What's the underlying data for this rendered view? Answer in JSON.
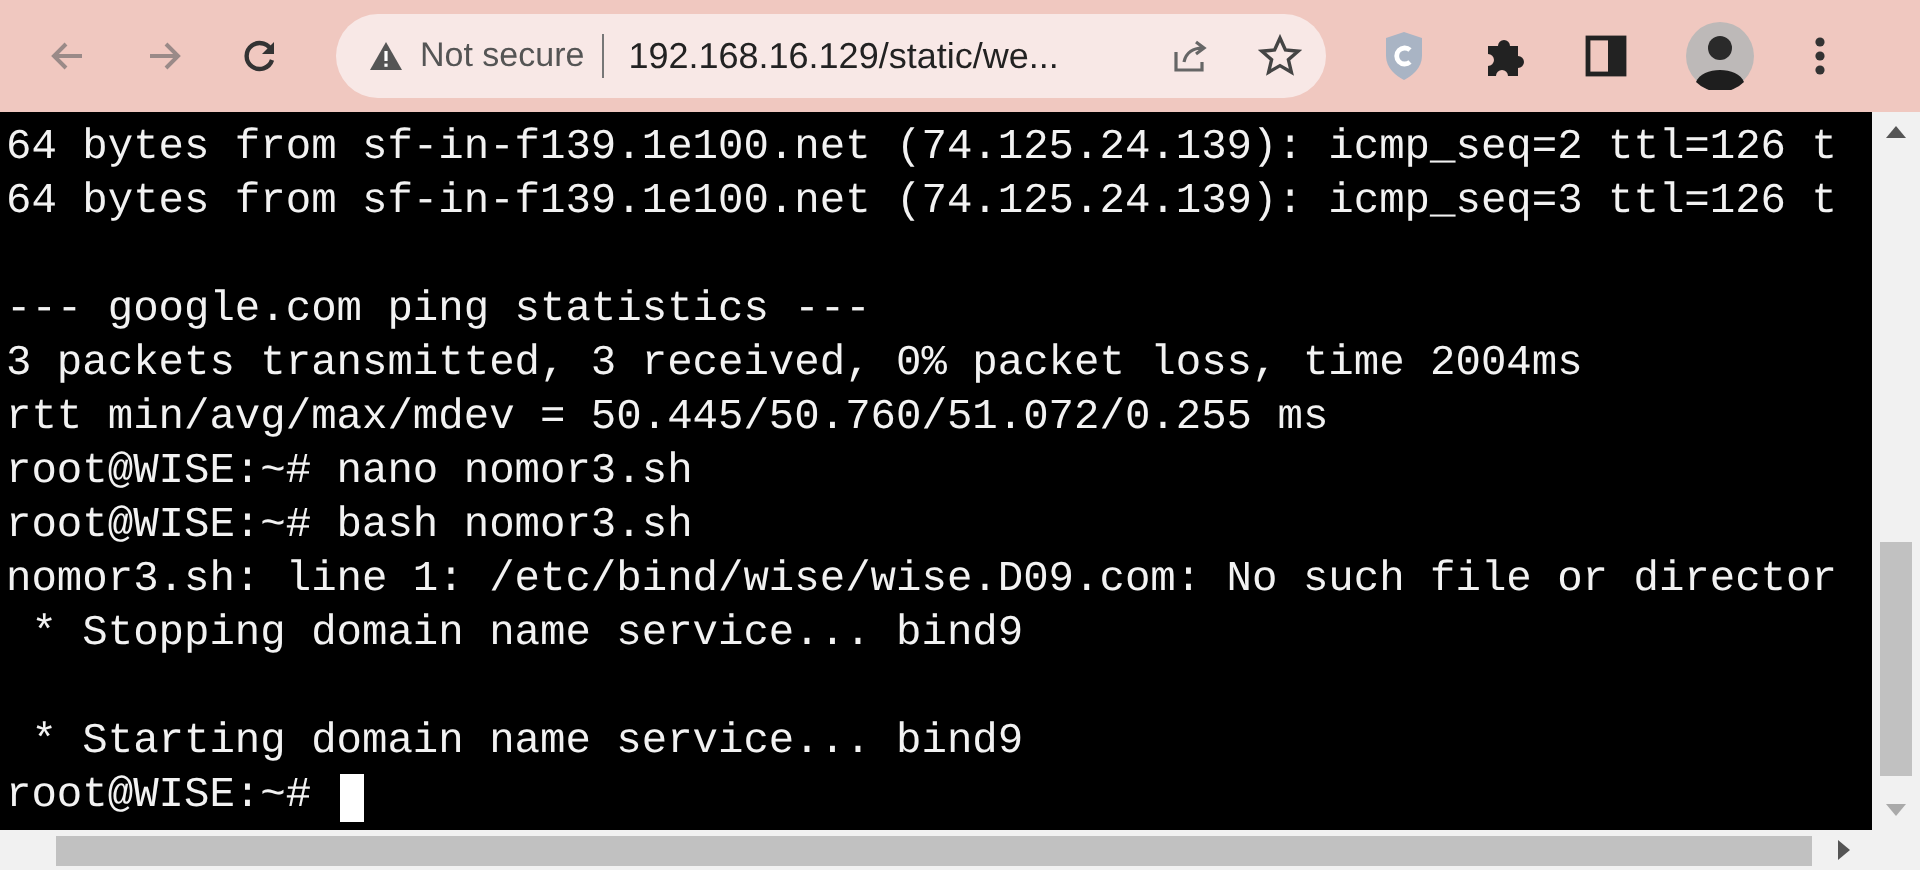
{
  "browser": {
    "security_label": "Not secure",
    "url": "192.168.16.129/static/we..."
  },
  "terminal": {
    "blocks": [
      [
        "64 bytes from sf-in-f139.1e100.net (74.125.24.139): icmp_seq=2 ttl=126 t",
        "64 bytes from sf-in-f139.1e100.net (74.125.24.139): icmp_seq=3 ttl=126 t"
      ],
      [
        "--- google.com ping statistics ---",
        "3 packets transmitted, 3 received, 0% packet loss, time 2004ms",
        "rtt min/avg/max/mdev = 50.445/50.760/51.072/0.255 ms",
        "root@WISE:~# nano nomor3.sh",
        "root@WISE:~# bash nomor3.sh",
        "nomor3.sh: line 1: /etc/bind/wise/wise.D09.com: No such file or director",
        " * Stopping domain name service... bind9"
      ],
      [
        " * Starting domain name service... bind9"
      ]
    ],
    "prompt": "root@WISE:~#"
  }
}
